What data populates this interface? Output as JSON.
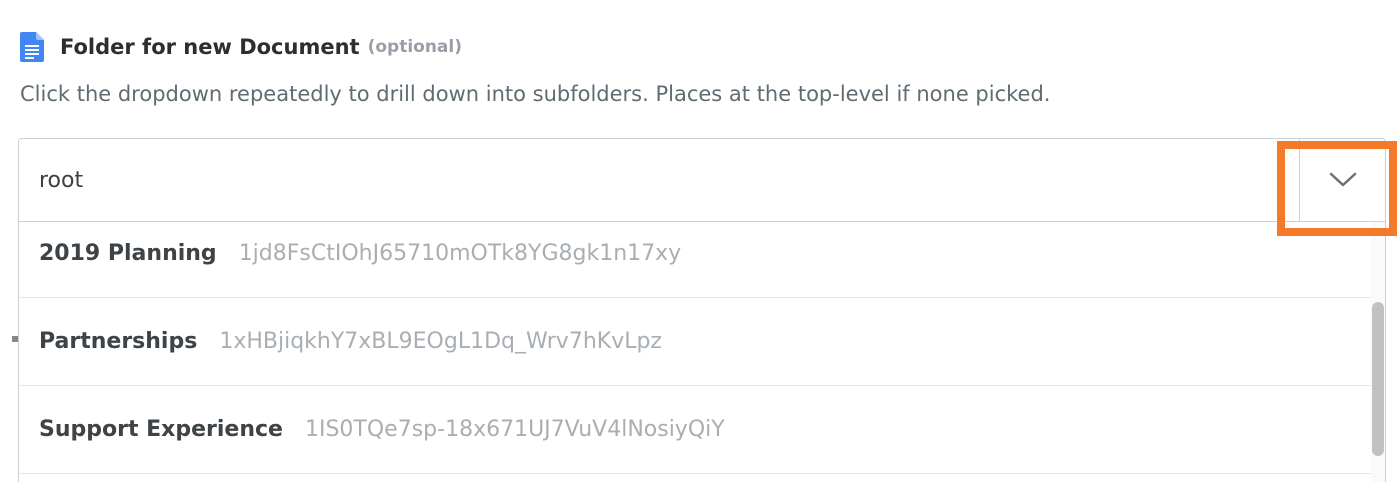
{
  "field": {
    "title": "Folder for new Document",
    "optional_label": "(optional)",
    "help_text": "Click the dropdown repeatedly to drill down into subfolders. Places at the top-level if none picked.",
    "icon": "google-docs-icon"
  },
  "select": {
    "value": "root",
    "toggle_icon": "chevron-down-icon"
  },
  "options": [
    {
      "name": "2019 Planning",
      "id": "1jd8FsCtIOhJ65710mOTk8YG8gk1n17xy"
    },
    {
      "name": "Partnerships",
      "id": "1xHBjiqkhY7xBL9EOgL1Dq_Wrv7hKvLpz"
    },
    {
      "name": "Support Experience",
      "id": "1IS0TQe7sp-18x671UJ7VuV4lNosiyQiY"
    }
  ],
  "colors": {
    "highlight": "#f5792a",
    "doc_icon": "#4285f4",
    "option_id_text": "#a9aeb3"
  }
}
